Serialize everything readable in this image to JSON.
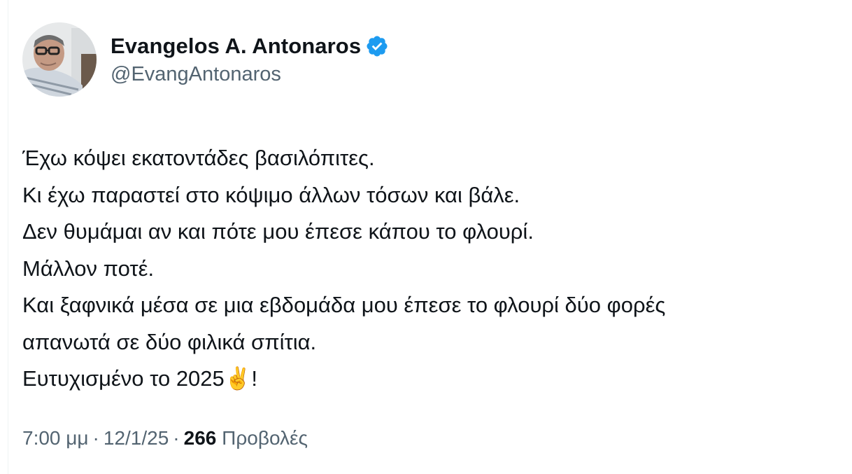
{
  "author": {
    "display_name": "Evangelos A. Antonaros",
    "handle": "@EvangAntonaros",
    "verified": true,
    "avatar_icon": "user-avatar-photo",
    "verified_icon": "verified-badge-icon",
    "accent_color": "#1d9bf0"
  },
  "tweet": {
    "lines": [
      "Έχω κόψει εκατοντάδες βασιλόπιτες.",
      "Κι έχω παραστεί στο κόψιμο άλλων τόσων και βάλε.",
      "Δεν θυμάμαι αν και πότε μου έπεσε κάπου το φλουρί.",
      "Μάλλον ποτέ.",
      "Και ξαφνικά μέσα σε μια εβδομάδα μου έπεσε το φλουρί δύο φορές",
      "απανωτά σε δύο φιλικά σπίτια.",
      "Ευτυχισμένο το 2025"
    ],
    "last_line_emoji": "✌️",
    "last_line_suffix": "!"
  },
  "meta": {
    "time": "7:00 μμ",
    "separator": "·",
    "date": "12/1/25",
    "views_count": "266",
    "views_label": "Προβολές"
  }
}
